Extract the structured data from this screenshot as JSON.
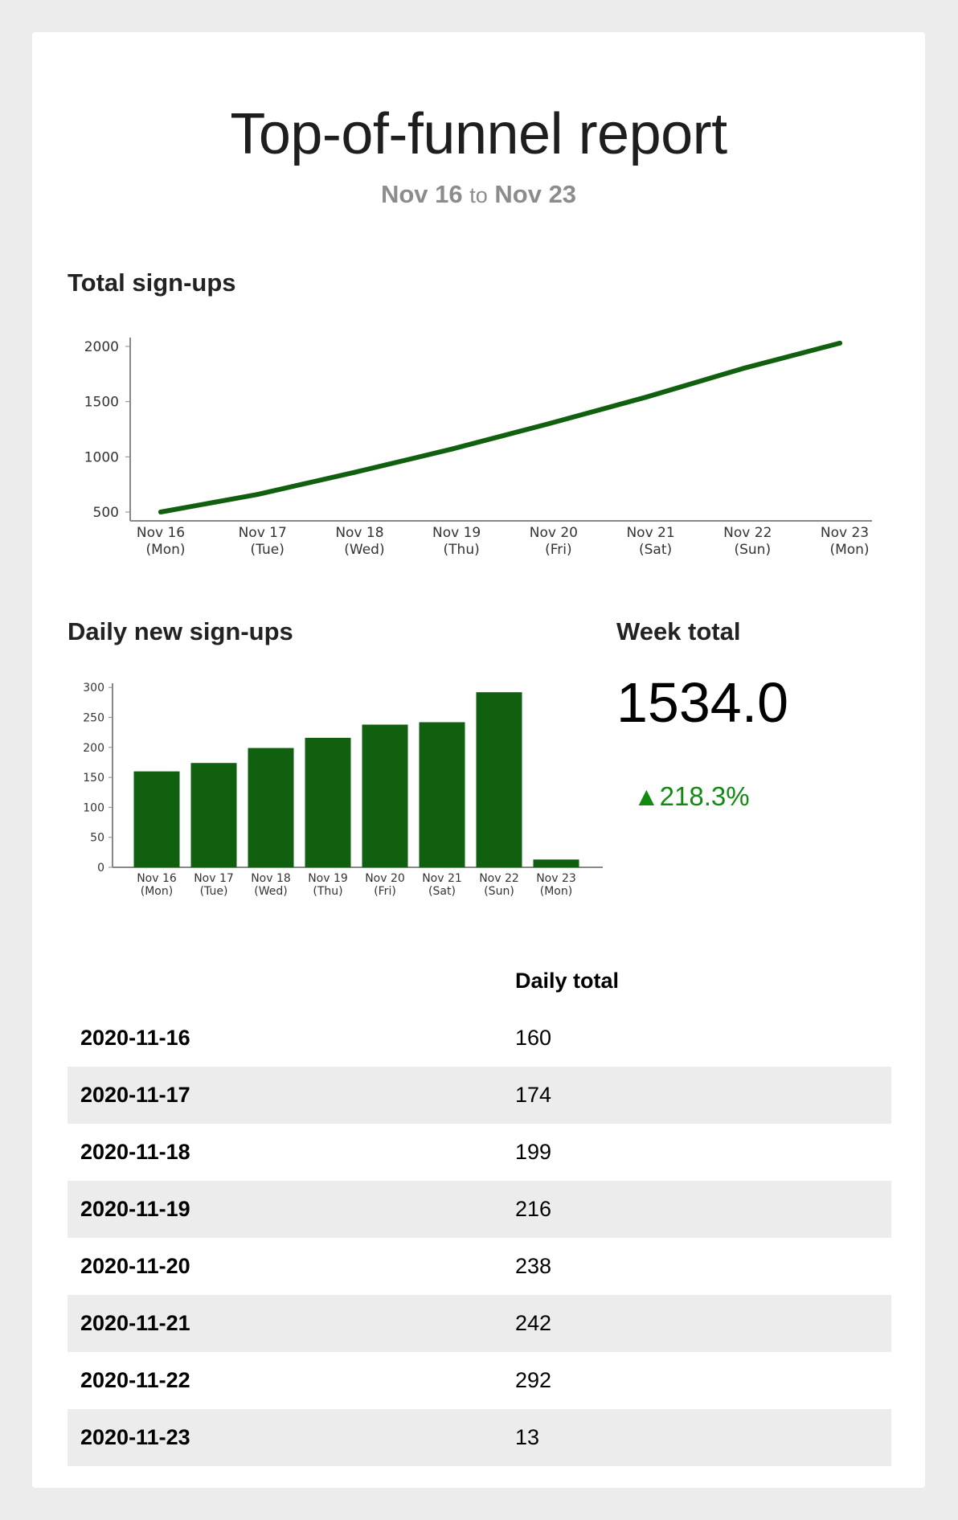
{
  "report": {
    "title": "Top-of-funnel report",
    "range_start": "Nov 16",
    "range_connector": "to",
    "range_end": "Nov 23"
  },
  "sections": {
    "total_signups_title": "Total sign-ups",
    "daily_signups_title": "Daily new sign-ups",
    "week_total_title": "Week total"
  },
  "week_total": {
    "value": "1534.0",
    "change": "▲218.3%",
    "change_color": "#118a11"
  },
  "chart_data": [
    {
      "type": "line",
      "title": "Total sign-ups",
      "x": [
        "Nov 16 (Mon)",
        "Nov 17 (Tue)",
        "Nov 18 (Wed)",
        "Nov 19 (Thu)",
        "Nov 20 (Fri)",
        "Nov 21 (Sat)",
        "Nov 22 (Sun)",
        "Nov 23 (Mon)"
      ],
      "x_ticks": [
        [
          "Nov 16",
          "(Mon)"
        ],
        [
          "Nov 17",
          "(Tue)"
        ],
        [
          "Nov 18",
          "(Wed)"
        ],
        [
          "Nov 19",
          "(Thu)"
        ],
        [
          "Nov 20",
          "(Fri)"
        ],
        [
          "Nov 21",
          "(Sat)"
        ],
        [
          "Nov 22",
          "(Sun)"
        ],
        [
          "Nov 23",
          "(Mon)"
        ]
      ],
      "series": [
        {
          "values": [
            500,
            660,
            860,
            1070,
            1300,
            1540,
            1800,
            2030
          ],
          "color": "#11600f"
        }
      ],
      "yticks": [
        500,
        1000,
        1500,
        2000
      ],
      "ylim": [
        420,
        2080
      ],
      "grid": false
    },
    {
      "type": "bar",
      "title": "Daily new sign-ups",
      "categories": [
        "Nov 16 (Mon)",
        "Nov 17 (Tue)",
        "Nov 18 (Wed)",
        "Nov 19 (Thu)",
        "Nov 20 (Fri)",
        "Nov 21 (Sat)",
        "Nov 22 (Sun)",
        "Nov 23 (Mon)"
      ],
      "x_ticks": [
        [
          "Nov 16",
          "(Mon)"
        ],
        [
          "Nov 17",
          "(Tue)"
        ],
        [
          "Nov 18",
          "(Wed)"
        ],
        [
          "Nov 19",
          "(Thu)"
        ],
        [
          "Nov 20",
          "(Fri)"
        ],
        [
          "Nov 21",
          "(Sat)"
        ],
        [
          "Nov 22",
          "(Sun)"
        ],
        [
          "Nov 23",
          "(Mon)"
        ]
      ],
      "values": [
        160,
        174,
        199,
        216,
        238,
        242,
        292,
        13
      ],
      "color": "#11600f",
      "yticks": [
        0,
        50,
        100,
        150,
        200,
        250,
        300
      ],
      "ylim": [
        0,
        307
      ],
      "grid": false
    }
  ],
  "daily_table": {
    "header": "Daily total",
    "rows": [
      {
        "date": "2020-11-16",
        "total": "160"
      },
      {
        "date": "2020-11-17",
        "total": "174"
      },
      {
        "date": "2020-11-18",
        "total": "199"
      },
      {
        "date": "2020-11-19",
        "total": "216"
      },
      {
        "date": "2020-11-20",
        "total": "238"
      },
      {
        "date": "2020-11-21",
        "total": "242"
      },
      {
        "date": "2020-11-22",
        "total": "292"
      },
      {
        "date": "2020-11-23",
        "total": "13"
      }
    ]
  }
}
